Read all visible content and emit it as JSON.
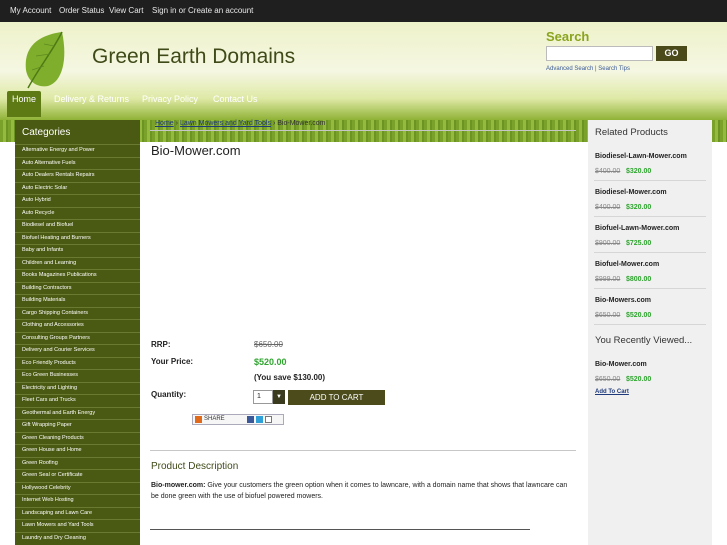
{
  "topbar": {
    "links": [
      "My Account",
      "Order Status",
      "View Cart",
      "Sign in or Create an account"
    ]
  },
  "header": {
    "site_title": "Green Earth Domains"
  },
  "search": {
    "label": "Search",
    "button": "GO",
    "advanced": "Advanced Search",
    "divider": "|",
    "tips": "Search Tips"
  },
  "nav": {
    "items": [
      "Home",
      "Delivery & Returns",
      "Privacy Policy",
      "Contact Us"
    ]
  },
  "sidebar": {
    "title": "Categories",
    "items": [
      "Alternative Energy and Power",
      "Auto Alternative Fuels",
      "Auto Dealers Rentals Repairs",
      "Auto Electric Solar",
      "Auto Hybrid",
      "Auto Recycle",
      "Biodiesel and Biofuel",
      "Biofuel Heating and Burners",
      "Baby and Infants",
      "Children and Learning",
      "Books Magazines Publications",
      "Building Contractors",
      "Building Materials",
      "Cargo Shipping Containers",
      "Clothing and Accessories",
      "Consulting Groups Partners",
      "Delivery and Courier Services",
      "Eco Friendly Products",
      "Eco Green Businesses",
      "Electricity and Lighting",
      "Fleet Cars and Trucks",
      "Geothermal and Earth Energy",
      "Gift Wrapping Paper",
      "Green Cleaning Products",
      "Green House and Home",
      "Green Roofing",
      "Green Seal or Certificate",
      "Hollywood Celebrity",
      "Internet Web Hosting",
      "Landscaping and Lawn Care",
      "Lawn Mowers and Yard Tools",
      "Laundry and Dry Cleaning"
    ]
  },
  "breadcrumb": {
    "home": "Home",
    "category": "Lawn Mowers and Yard Tools",
    "current": "Bio-Mower.com",
    "sep": "›"
  },
  "product": {
    "title": "Bio-Mower.com",
    "rrp_label": "RRP:",
    "rrp": "$650.00",
    "price_label": "Your Price:",
    "price": "$520.00",
    "savings": "(You save $130.00)",
    "qty_label": "Quantity:",
    "qty": "1",
    "add_to_cart": "ADD TO CART",
    "share": "SHARE"
  },
  "description": {
    "heading": "Product Description",
    "bold": "Bio-mower.com:",
    "text": " Give your customers the green option when it comes to lawncare, with a domain name that shows that lawncare can be done green with the use of biofuel powered mowers."
  },
  "related": {
    "title": "Related Products",
    "items": [
      {
        "name": "Biodiesel-Lawn-Mower.com",
        "old": "$400.00",
        "new": "$320.00"
      },
      {
        "name": "Biodiesel-Mower.com",
        "old": "$400.00",
        "new": "$320.00"
      },
      {
        "name": "Biofuel-Lawn-Mower.com",
        "old": "$900.00",
        "new": "$725.00"
      },
      {
        "name": "Biofuel-Mower.com",
        "old": "$999.00",
        "new": "$800.00"
      },
      {
        "name": "Bio-Mowers.com",
        "old": "$650.00",
        "new": "$520.00"
      }
    ]
  },
  "recent": {
    "title": "You Recently Viewed...",
    "item": {
      "name": "Bio-Mower.com",
      "old": "$650.00",
      "new": "$520.00",
      "link": "Add To Cart"
    }
  }
}
